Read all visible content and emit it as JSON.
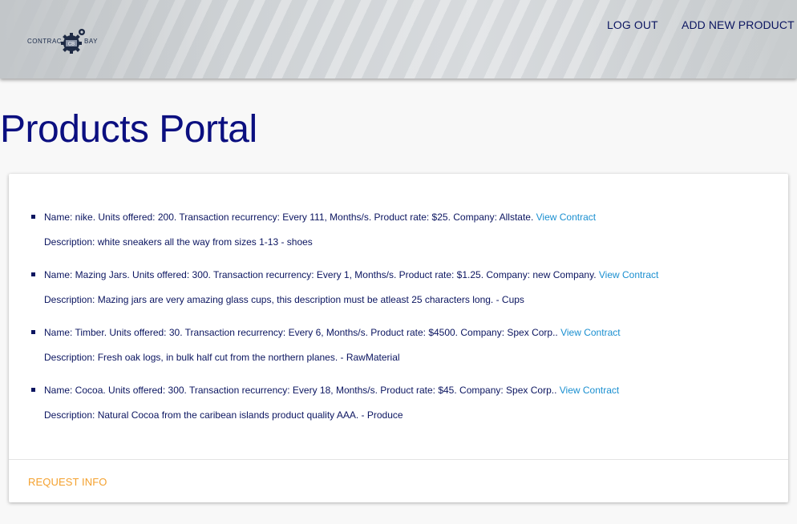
{
  "header": {
    "logo": {
      "text_left": "CONTRAC",
      "text_right": "BAY",
      "badge": "CB"
    },
    "nav": {
      "logout": "LOG OUT",
      "add_new_product": "ADD NEW PRODUCT"
    }
  },
  "page": {
    "title": "Products Portal"
  },
  "products": [
    {
      "summary": "Name: nike. Units offered: 200. Transaction recurrency: Every 111, Months/s. Product rate: $25. Company: Allstate.",
      "link": "View Contract",
      "description": "Description: white sneakers all the way from sizes 1-13 - shoes"
    },
    {
      "summary": "Name: Mazing Jars. Units offered: 300. Transaction recurrency: Every 1, Months/s. Product rate: $1.25. Company: new Company.",
      "link": "View Contract",
      "description": "Description: Mazing jars are very amazing glass cups, this description must be atleast 25 characters long. - Cups"
    },
    {
      "summary": "Name: Timber. Units offered: 30. Transaction recurrency: Every 6, Months/s. Product rate: $4500. Company: Spex Corp..",
      "link": "View Contract",
      "description": "Description: Fresh oak logs, in bulk half cut from the northern planes. - RawMaterial"
    },
    {
      "summary": "Name: Cocoa. Units offered: 300. Transaction recurrency: Every 18, Months/s. Product rate: $45. Company: Spex Corp..",
      "link": "View Contract",
      "description": "Description: Natural Cocoa from the caribean islands product quality AAA. - Produce"
    }
  ],
  "card_actions": {
    "request_info": "REQUEST INFO"
  },
  "colors": {
    "title": "#0b0f80",
    "text": "#0b1560",
    "link": "#1a8fd0",
    "action": "#f4a12e"
  }
}
